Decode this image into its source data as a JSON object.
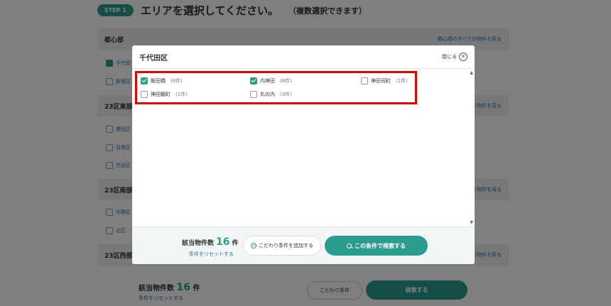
{
  "step": {
    "badge": "STEP 1",
    "title": "エリアを選択してください。",
    "subtitle": "（複数選択できます）"
  },
  "background": {
    "regions": [
      {
        "title": "都心部",
        "link": "都心部のすべての物件を見る"
      },
      {
        "title": "23区東部",
        "link": "の物件を見る"
      },
      {
        "title": "23区南部",
        "link": "の物件を見る"
      },
      {
        "title": "23区西部",
        "link": "の物件を見る"
      }
    ],
    "items": [
      "千代田",
      "新宿区",
      "墨田区",
      "目黒区",
      "渋谷区",
      "中野区",
      "北区"
    ],
    "footer": {
      "count_label": "該当物件数",
      "count": "16",
      "unit": "件",
      "reset": "条件をリセットする",
      "extra_button": "こだわり条件",
      "search_button": "検索する"
    }
  },
  "modal": {
    "title": "千代田区",
    "close_label": "閉じる",
    "options": [
      {
        "name": "飯田橋",
        "count": "(8件)",
        "checked": true
      },
      {
        "name": "内神田",
        "count": "(8件)",
        "checked": true
      },
      {
        "name": "神田司町",
        "count": "(1件)",
        "checked": false
      },
      {
        "name": "神田鍛町",
        "count": "(1件)",
        "checked": false
      },
      {
        "name": "丸の内",
        "count": "(3件)",
        "checked": false
      }
    ],
    "footer": {
      "count_label": "該当物件数",
      "count": "16",
      "unit": "件",
      "reset": "条件をリセットする",
      "add_condition": "こだわり条件を追加する",
      "search": "この条件で検索する"
    }
  },
  "colors": {
    "accent": "#2a9d8f",
    "highlight": "#e00000",
    "link": "#2a6bb3"
  }
}
